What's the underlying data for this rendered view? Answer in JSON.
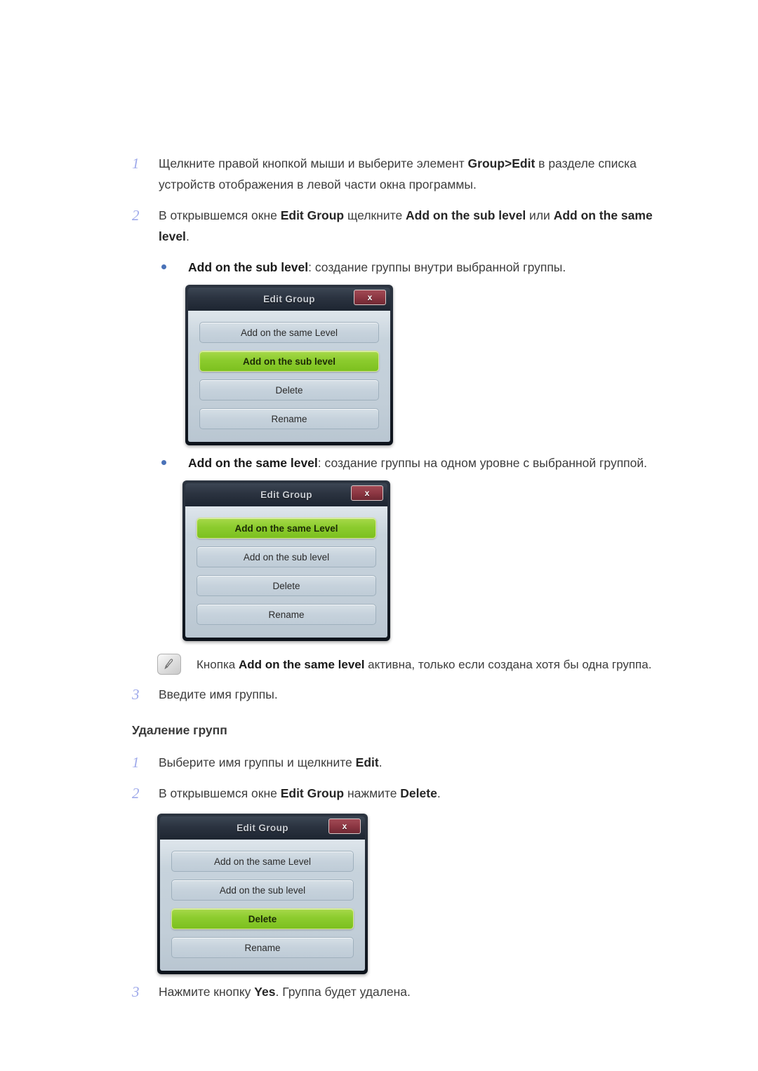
{
  "document": {
    "language": "ru",
    "accent_number_color": "#9ea9ea",
    "bullet_color": "#4a72b8",
    "highlight_button_color": "#8ccc2e",
    "close_button_color": "#8d3743"
  },
  "steps_create": [
    {
      "number": "1",
      "parts": [
        {
          "text": "Щелкните правой кнопкой мыши и выберите элемент ",
          "bold": false
        },
        {
          "text": "Group>Edit",
          "bold": true
        },
        {
          "text": " в разделе списка устройств отображения в левой части окна программы.",
          "bold": false
        }
      ]
    },
    {
      "number": "2",
      "parts": [
        {
          "text": "В открывшемся окне ",
          "bold": false
        },
        {
          "text": "Edit Group",
          "bold": true
        },
        {
          "text": " щелкните ",
          "bold": false
        },
        {
          "text": "Add on the sub level",
          "bold": true
        },
        {
          "text": " или ",
          "bold": false
        },
        {
          "text": "Add on the same level",
          "bold": true
        },
        {
          "text": ".",
          "bold": false
        }
      ]
    }
  ],
  "bullets": [
    {
      "marker": "bullet-dot",
      "parts": [
        {
          "text": "Add on the sub level",
          "bold": true
        },
        {
          "text": ": создание группы внутри выбранной группы.",
          "bold": false
        }
      ]
    },
    {
      "marker": "bullet-dot",
      "parts": [
        {
          "text": "Add on the same level",
          "bold": true
        },
        {
          "text": ": создание группы на одном уровне с выбранной группой.",
          "bold": false
        }
      ]
    }
  ],
  "dialogs": [
    {
      "id": "dialog-sub-level",
      "title": "Edit Group",
      "close_label": "x",
      "buttons": [
        {
          "label": "Add on the same Level",
          "active": false
        },
        {
          "label": "Add on the sub level",
          "active": true
        },
        {
          "label": "Delete",
          "active": false
        },
        {
          "label": "Rename",
          "active": false
        }
      ]
    },
    {
      "id": "dialog-same-level",
      "title": "Edit Group",
      "close_label": "x",
      "buttons": [
        {
          "label": "Add on the same Level",
          "active": true
        },
        {
          "label": "Add on the sub level",
          "active": false
        },
        {
          "label": "Delete",
          "active": false
        },
        {
          "label": "Rename",
          "active": false
        }
      ]
    },
    {
      "id": "dialog-delete",
      "title": "Edit Group",
      "close_label": "x",
      "buttons": [
        {
          "label": "Add on the same Level",
          "active": false
        },
        {
          "label": "Add on the sub level",
          "active": false
        },
        {
          "label": "Delete",
          "active": true
        },
        {
          "label": "Rename",
          "active": false
        }
      ]
    }
  ],
  "note": {
    "icon": "note-pencil-icon",
    "parts": [
      {
        "text": "Кнопка ",
        "bold": false
      },
      {
        "text": "Add on the same level",
        "bold": true
      },
      {
        "text": " активна, только если создана хотя бы одна группа.",
        "bold": false
      }
    ]
  },
  "step_create_3": {
    "number": "3",
    "parts": [
      {
        "text": "Введите имя группы.",
        "bold": false
      }
    ]
  },
  "section_delete": {
    "heading": "Удаление групп",
    "steps": [
      {
        "number": "1",
        "parts": [
          {
            "text": "Выберите имя группы и щелкните ",
            "bold": false
          },
          {
            "text": "Edit",
            "bold": true
          },
          {
            "text": ".",
            "bold": false
          }
        ]
      },
      {
        "number": "2",
        "parts": [
          {
            "text": "В открывшемся окне ",
            "bold": false
          },
          {
            "text": "Edit Group",
            "bold": true
          },
          {
            "text": " нажмите ",
            "bold": false
          },
          {
            "text": "Delete",
            "bold": true
          },
          {
            "text": ".",
            "bold": false
          }
        ]
      },
      {
        "number": "3",
        "parts": [
          {
            "text": "Нажмите кнопку ",
            "bold": false
          },
          {
            "text": "Yes",
            "bold": true
          },
          {
            "text": ". Группа будет удалена.",
            "bold": false
          }
        ]
      }
    ]
  }
}
